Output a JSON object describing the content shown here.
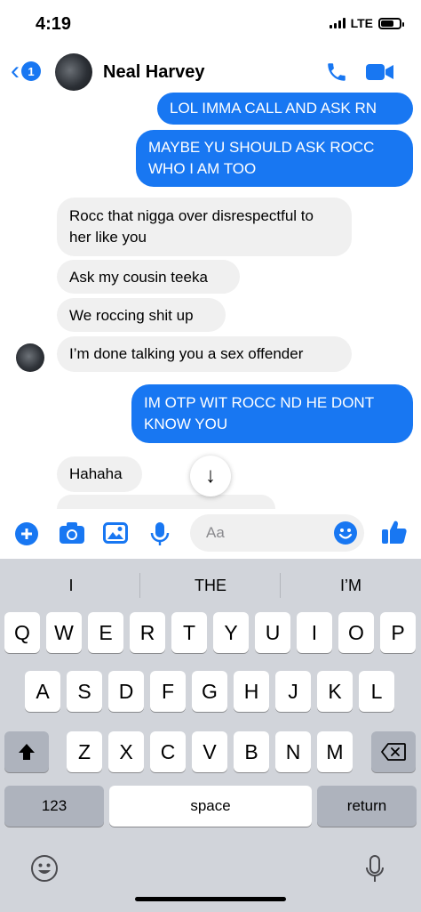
{
  "status": {
    "time": "4:19",
    "network": "LTE",
    "battery_level": 0.8
  },
  "header": {
    "back_badge": "1",
    "contact_name": "Neal Harvey"
  },
  "messages": [
    {
      "dir": "out",
      "text": "LOL IMMA CALL AND ASK RN"
    },
    {
      "dir": "out",
      "text": "MAYBE YU SHOULD ASK ROCC WHO I AM TOO"
    },
    {
      "dir": "in",
      "text": "Rocc that nigga over disrespectful to her like you"
    },
    {
      "dir": "in",
      "text": "Ask my cousin teeka"
    },
    {
      "dir": "in",
      "text": "We roccing shit up"
    },
    {
      "dir": "in",
      "text": "I’m done talking you a sex offender"
    },
    {
      "dir": "out",
      "text": "IM OTP WIT ROCC ND HE DONT KNOW YOU"
    },
    {
      "dir": "in",
      "text": "Hahaha"
    }
  ],
  "compose": {
    "placeholder": "Aa"
  },
  "keyboard": {
    "suggestions": [
      "I",
      "THE",
      "I’M"
    ],
    "row1": [
      "Q",
      "W",
      "E",
      "R",
      "T",
      "Y",
      "U",
      "I",
      "O",
      "P"
    ],
    "row2": [
      "A",
      "S",
      "D",
      "F",
      "G",
      "H",
      "J",
      "K",
      "L"
    ],
    "row3": [
      "Z",
      "X",
      "C",
      "V",
      "B",
      "N",
      "M"
    ],
    "numbers_label": "123",
    "space_label": "space",
    "return_label": "return"
  },
  "colors": {
    "accent": "#1877f2",
    "incoming_bubble": "#f0f0f0",
    "keyboard_bg": "#d1d4da"
  }
}
